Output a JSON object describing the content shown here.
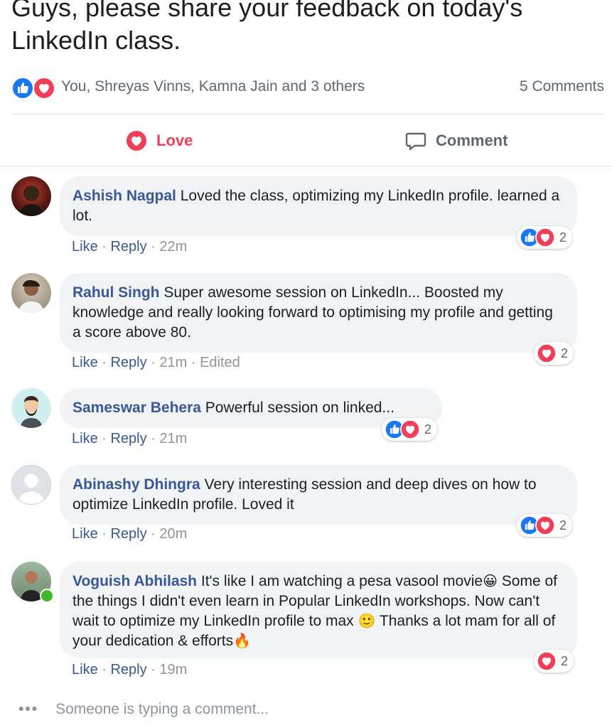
{
  "post": {
    "text": "Guys, please share your feedback on today's LinkedIn class.",
    "reaction_summary": "You, Shreyas Vinns, Kamna Jain and 3 others",
    "comment_count": "5 Comments",
    "reaction_icons": [
      "like-icon",
      "love-icon"
    ]
  },
  "actions": {
    "love_label": "Love",
    "comment_label": "Comment"
  },
  "colors": {
    "like_blue": "#1877f2",
    "love_red": "#f33e58",
    "link_blue": "#385898",
    "bubble_bg": "#f2f3f5"
  },
  "comments": [
    {
      "author": "Ashish Nagpal",
      "text": "Loved the class, optimizing my LinkedIn profile. learned a lot.",
      "like": "Like",
      "reply": "Reply",
      "time": "22m",
      "edited": "",
      "reaction_count": "2",
      "reaction_icons": [
        "like-icon",
        "love-icon"
      ]
    },
    {
      "author": "Rahul Singh",
      "text": "Super awesome session on LinkedIn... Boosted my knowledge and really looking forward to optimising my profile and getting a score above 80.",
      "like": "Like",
      "reply": "Reply",
      "time": "21m",
      "edited": "Edited",
      "reaction_count": "2",
      "reaction_icons": [
        "love-icon"
      ]
    },
    {
      "author": "Sameswar Behera",
      "text": "Powerful session on linked...",
      "like": "Like",
      "reply": "Reply",
      "time": "21m",
      "edited": "",
      "reaction_count": "2",
      "reaction_icons": [
        "like-icon",
        "love-icon"
      ]
    },
    {
      "author": "Abinashy Dhingra",
      "text": "Very interesting session and deep dives on how to optimize LinkedIn profile. Loved it",
      "like": "Like",
      "reply": "Reply",
      "time": "20m",
      "edited": "",
      "reaction_count": "2",
      "reaction_icons": [
        "like-icon",
        "love-icon"
      ]
    },
    {
      "author": "Voguish Abhilash",
      "text_line1": "It's like I am watching a pesa vasool movie",
      "text_line2": "Some of the things I didn't even learn in Popular LinkedIn workshops. Now can't wait to optimize my LinkedIn profile to max",
      "text_line3": "Thanks a lot mam for all of your dedication & efforts",
      "emoji_grin": "😀",
      "emoji_smile": "🙂",
      "emoji_fire": "🔥",
      "like": "Like",
      "reply": "Reply",
      "time": "19m",
      "edited": "",
      "reaction_count": "2",
      "reaction_icons": [
        "love-icon"
      ]
    }
  ],
  "typing": {
    "dots": "•••",
    "text": "Someone is typing a comment..."
  }
}
